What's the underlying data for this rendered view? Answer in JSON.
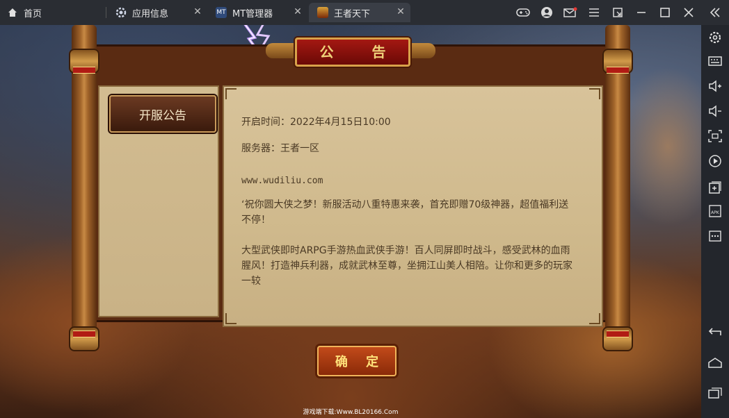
{
  "tabs": [
    {
      "label": "首页",
      "icon": "home-icon"
    },
    {
      "label": "应用信息",
      "icon": "settings-icon"
    },
    {
      "label": "MT管理器",
      "icon": "mt-app-icon"
    },
    {
      "label": "王者天下",
      "icon": "game-app-icon",
      "active": true
    }
  ],
  "window_controls": [
    "gamepad-icon",
    "user-avatar-icon",
    "mail-icon",
    "menu-icon",
    "restore-small-icon",
    "minimize-icon",
    "maximize-icon",
    "close-icon",
    "collapse-icon"
  ],
  "sidebar_tools": [
    "settings-icon",
    "keyboard-icon",
    "volume-up-icon",
    "volume-down-icon",
    "screenshot-icon",
    "record-icon",
    "add-window-icon",
    "install-apk-icon",
    "more-icon",
    "back-icon",
    "home-icon",
    "recent-apps-icon"
  ],
  "notice": {
    "title": "公 告",
    "side_button": "开服公告",
    "open_time": "开启时间：2022年4月15日10:00",
    "server": "服务器：王者一区",
    "site": "www.wudiliu.com",
    "para1": "‘祝你圆大侠之梦！新服活动八重特惠来袭，首充即赠70级神器，超值福利送不停！",
    "para2": "大型武侠即时ARPG手游热血武侠手游！百人同屏即时战斗，感受武林的血雨腥风！打造神兵利器，成就武林至尊，坐拥江山美人相陪。让你和更多的玩家一较",
    "confirm": "确 定"
  },
  "footer": "游戏端下载:Www.BL20166.Com",
  "colors": {
    "tabbar": "#2a2d33",
    "sidebar": "#23262c",
    "parchment": "#d2bc91",
    "title_red": "#a41812",
    "gold": "#f0d27a"
  }
}
